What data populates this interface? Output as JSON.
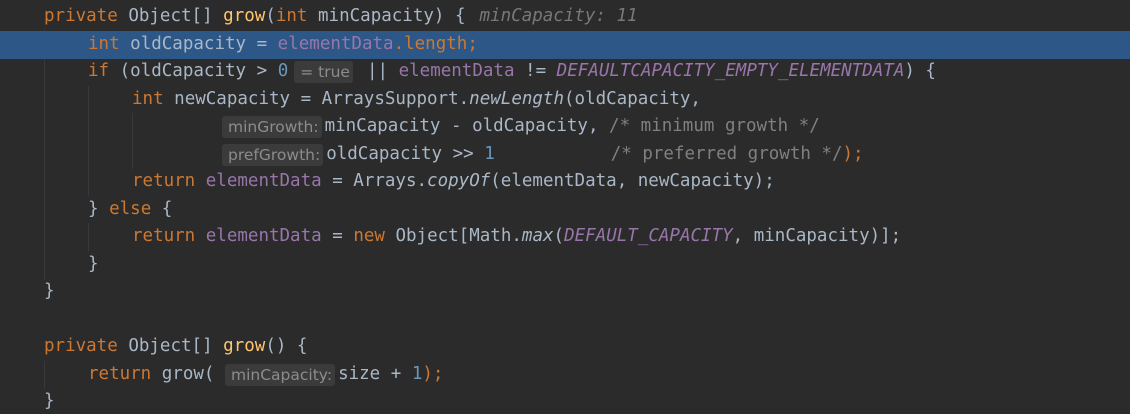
{
  "editor": {
    "debug_value": "minCapacity: 11",
    "hints": {
      "true_value": "= true",
      "min_growth": "minGrowth:",
      "pref_growth": "prefGrowth:",
      "min_capacity": "minCapacity:"
    },
    "tokens": {
      "private": "private",
      "object_array": "Object[]",
      "grow": "grow",
      "open_paren": "(",
      "int": "int",
      "min_capacity_param": "minCapacity)",
      "brace_open": "{",
      "old_capacity_decl": "oldCapacity =",
      "element_data": "elementData",
      "dot_length": ".length;",
      "if": "if",
      "if_cond_start": "(oldCapacity >",
      "zero": "0",
      "or": "||",
      "neq": "!=",
      "default_empty": "DEFAULTCAPACITY_EMPTY_ELEMENTDATA",
      "close_brace_open": ") {",
      "new_capacity_decl": "newCapacity = ArraysSupport.",
      "new_length": "newLength",
      "new_length_args": "(oldCapacity,",
      "min_minus_old": "minCapacity - oldCapacity,",
      "comment_min": "/* minimum growth */",
      "old_shift": "oldCapacity >>",
      "one": "1",
      "comment_pref": "/* preferred growth */",
      "close_paren_semi": ");",
      "return": "return",
      "assign_arrays": "= Arrays.",
      "copy_of": "copyOf",
      "copy_of_args": "(elementData, newCapacity);",
      "close_brace": "}",
      "else": "else",
      "assign": "=",
      "new": "new",
      "object_math": "Object[Math.",
      "max": "max",
      "open_paren_only": "(",
      "default_capacity": "DEFAULT_CAPACITY",
      "max_args_end": ", minCapacity)];",
      "grow_empty_sig": "() {",
      "grow_call": "grow(",
      "size_plus": "size +",
      "one_close": "1);"
    }
  }
}
